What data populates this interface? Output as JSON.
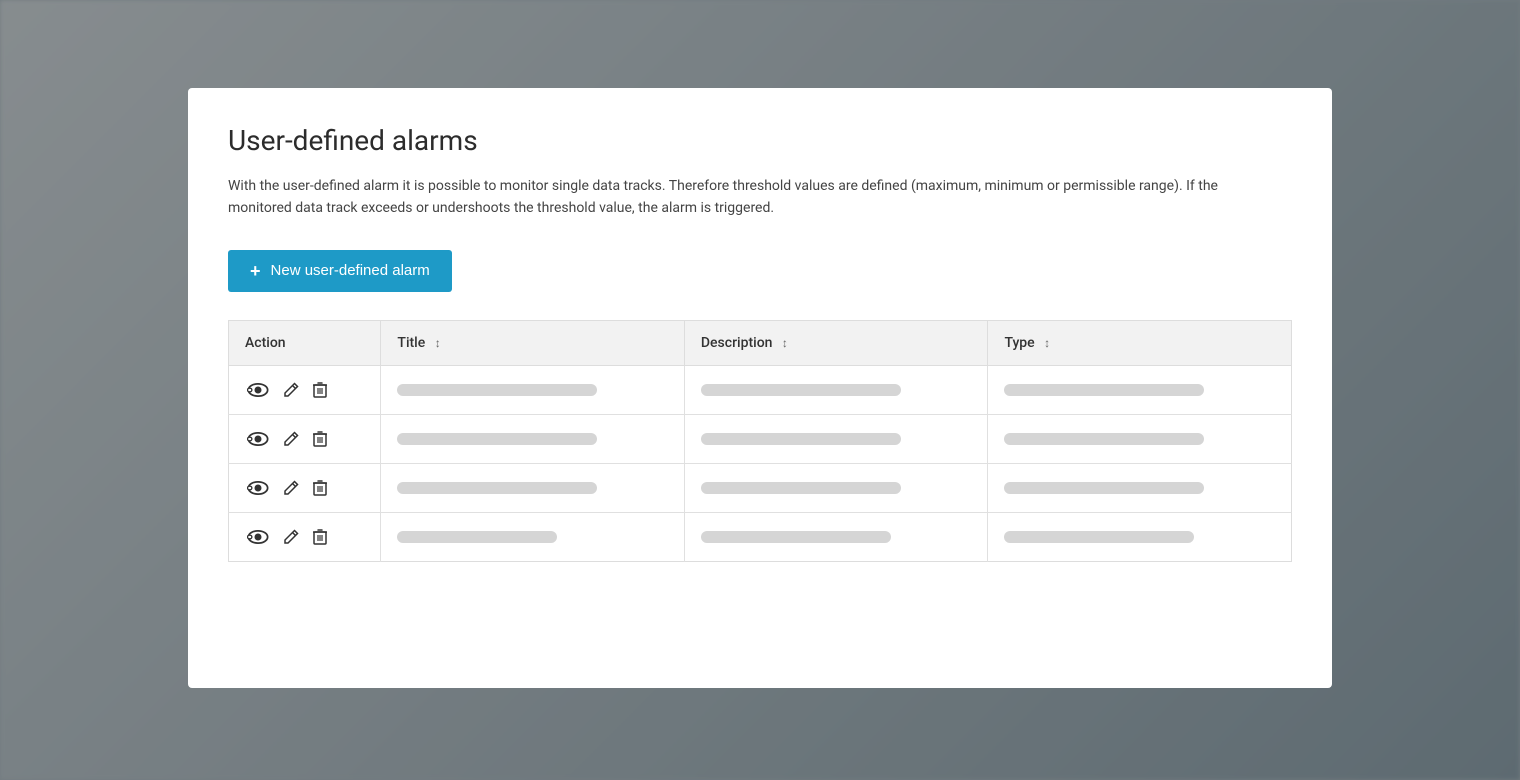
{
  "modal": {
    "title": "User-defined alarms",
    "description": "With the user-defined alarm it is possible to monitor single data tracks. Therefore threshold values are defined (maximum, minimum or permissible range). If the monitored data track exceeds or undershoots the threshold value, the alarm is triggered.",
    "new_alarm_button_label": "New user-defined alarm",
    "table": {
      "columns": [
        {
          "key": "action",
          "label": "Action",
          "sortable": false
        },
        {
          "key": "title",
          "label": "Title",
          "sortable": true
        },
        {
          "key": "description",
          "label": "Description",
          "sortable": true
        },
        {
          "key": "type",
          "label": "Type",
          "sortable": true
        }
      ],
      "rows": [
        {
          "id": 1
        },
        {
          "id": 2
        },
        {
          "id": 3
        },
        {
          "id": 4
        }
      ]
    }
  },
  "icons": {
    "plus": "+",
    "sort": "↕"
  }
}
